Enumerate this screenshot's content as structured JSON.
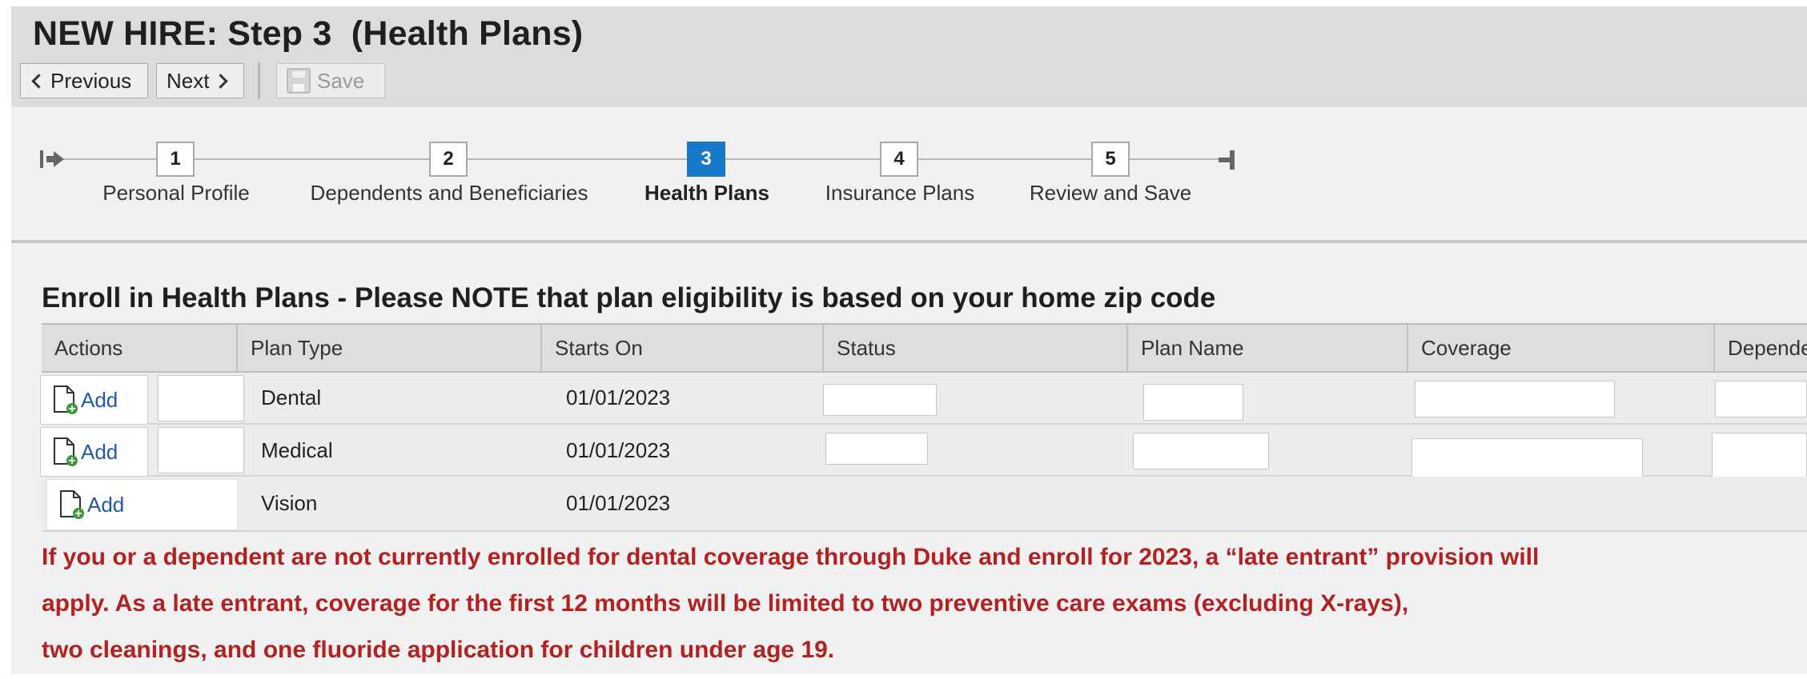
{
  "header": {
    "title": "NEW HIRE: Step 3  (Health Plans)"
  },
  "toolbar": {
    "previous_label": "Previous",
    "next_label": "Next",
    "save_label": "Save"
  },
  "steps": [
    {
      "number": "1",
      "label": "Personal Profile",
      "active": false
    },
    {
      "number": "2",
      "label": "Dependents and Beneficiaries",
      "active": false
    },
    {
      "number": "3",
      "label": "Health Plans",
      "active": true
    },
    {
      "number": "4",
      "label": "Insurance Plans",
      "active": false
    },
    {
      "number": "5",
      "label": "Review and Save",
      "active": false
    }
  ],
  "section": {
    "title": "Enroll in Health Plans - Please NOTE that plan eligibility is based on your home zip code"
  },
  "table": {
    "columns": [
      "Actions",
      "Plan Type",
      "Starts On",
      "Status",
      "Plan Name",
      "Coverage",
      "Depende"
    ],
    "rows": [
      {
        "action": "Add",
        "plan_type": "Dental",
        "starts_on": "01/01/2023"
      },
      {
        "action": "Add",
        "plan_type": "Medical",
        "starts_on": "01/01/2023"
      },
      {
        "action": "Add",
        "plan_type": "Vision",
        "starts_on": "01/01/2023"
      }
    ]
  },
  "notice": {
    "lines": [
      "If you or a dependent are not currently enrolled for dental coverage through Duke and enroll for 2023, a “late entrant” provision will",
      "apply.  As a late entrant, coverage for the first 12 months will be limited to two preventive care exams (excluding X-rays),",
      "two cleanings, and one fluoride application for children under age 19."
    ]
  },
  "colors": {
    "active_step": "#1779c8",
    "notice_text": "#b22222",
    "link": "#1f5aa6"
  }
}
